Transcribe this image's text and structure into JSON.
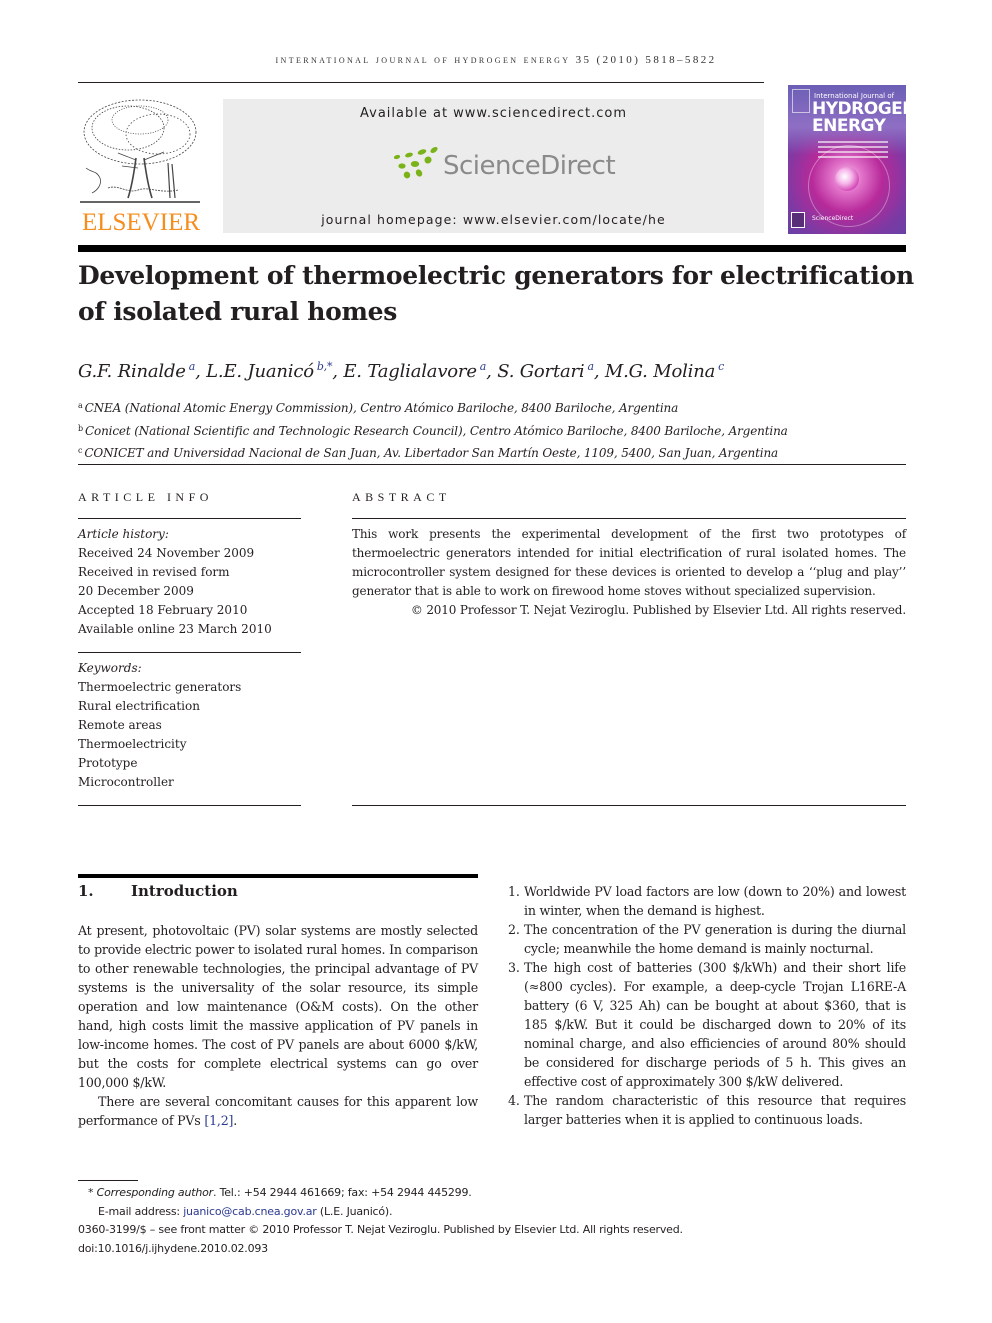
{
  "running_head": "International Journal of Hydrogen Energy 35 (2010) 5818–5822",
  "publisher": {
    "logo_word": "ELSEVIER",
    "available_at": "Available at www.sciencedirect.com",
    "sciencedirect_logo": "ScienceDirect",
    "journal_homepage": "journal homepage: www.elsevier.com/locate/he",
    "brand_color": "#f68d1f",
    "sd_green": "#7ab317"
  },
  "cover": {
    "line1": "International Journal of",
    "line2": "HYDROGEN",
    "line3": "ENERGY",
    "sd_label": "ScienceDirect"
  },
  "article": {
    "title": "Development of thermoelectric generators for electrification of isolated rural homes",
    "authors": [
      {
        "name": "G.F. Rinalde",
        "sup": "a"
      },
      {
        "name": "L.E. Juanicó",
        "sup": "b,*"
      },
      {
        "name": "E. Taglialavore",
        "sup": "a"
      },
      {
        "name": "S. Gortari",
        "sup": "a"
      },
      {
        "name": "M.G. Molina",
        "sup": "c"
      }
    ],
    "affiliations": [
      {
        "key": "a",
        "text": "CNEA (National Atomic Energy Commission), Centro Atómico Bariloche, 8400 Bariloche, Argentina"
      },
      {
        "key": "b",
        "text": "Conicet (National Scientific and Technologic Research Council), Centro Atómico Bariloche, 8400 Bariloche, Argentina"
      },
      {
        "key": "c",
        "text": "CONICET and Universidad Nacional de San Juan, Av. Libertador San Martín Oeste, 1109, 5400, San Juan, Argentina"
      }
    ]
  },
  "article_info": {
    "heading": "ARTICLE INFO",
    "history_label": "Article history:",
    "history": [
      "Received 24 November 2009",
      "Received in revised form",
      "20 December 2009",
      "Accepted 18 February 2010",
      "Available online 23 March 2010"
    ],
    "keywords_label": "Keywords:",
    "keywords": [
      "Thermoelectric generators",
      "Rural electrification",
      "Remote areas",
      "Thermoelectricity",
      "Prototype",
      "Microcontroller"
    ]
  },
  "abstract": {
    "heading": "ABSTRACT",
    "text": "This work presents the experimental development of the first two prototypes of thermoelectric generators intended for initial electrification of rural isolated homes. The microcontroller system designed for these devices is oriented to develop a ‘‘plug and play’’ generator that is able to work on firewood home stoves without specialized supervision.",
    "copyright": "© 2010 Professor T. Nejat Veziroglu. Published by Elsevier Ltd. All rights reserved."
  },
  "introduction": {
    "number": "1.",
    "heading": "Introduction",
    "para1": "At present, photovoltaic (PV) solar systems are mostly selected to provide electric power to isolated rural homes. In comparison to other renewable technologies, the principal advantage of PV systems is the universality of the solar resource, its simple operation and low maintenance (O&M costs). On the other hand, high costs limit the massive application of PV panels in low-income homes. The cost of PV panels are about 6000 $/kW, but the costs for complete electrical systems can go over 100,000 $/kW.",
    "para2_text": "There are several concomitant causes for this apparent low performance of PVs ",
    "para2_cite": "[1,2]",
    "para2_end": ".",
    "list": [
      {
        "n": "1.",
        "text": "Worldwide PV load factors are low (down to 20%) and lowest in winter, when the demand is highest."
      },
      {
        "n": "2.",
        "text": "The concentration of the PV generation is during the diurnal cycle; meanwhile the home demand is mainly nocturnal."
      },
      {
        "n": "3.",
        "text": "The high cost of batteries (300 $/kWh) and their short life (≈800 cycles). For example, a deep-cycle Trojan L16RE-A battery (6 V, 325 Ah) can be bought at about $360, that is 185 $/kW. But it could be discharged down to 20% of its nominal charge, and also efficiencies of around 80% should be considered for discharge periods of 5 h. This gives an effective cost of approximately 300 $/kW delivered."
      },
      {
        "n": "4.",
        "text": "The random characteristic of this resource that requires larger batteries when it is applied to continuous loads."
      }
    ]
  },
  "footnotes": {
    "star": "*",
    "corresponding_label": "Corresponding author",
    "contact": ". Tel.: +54 2944 461669; fax: +54 2944 445299.",
    "email_label": "E-mail address: ",
    "email": "juanico@cab.cnea.gov.ar",
    "email_owner": " (L.E. Juanicó).",
    "front_matter": "0360-3199/$ – see front matter © 2010 Professor T. Nejat Veziroglu. Published by Elsevier Ltd. All rights reserved.",
    "doi": "doi:10.1016/j.ijhydene.2010.02.093"
  }
}
